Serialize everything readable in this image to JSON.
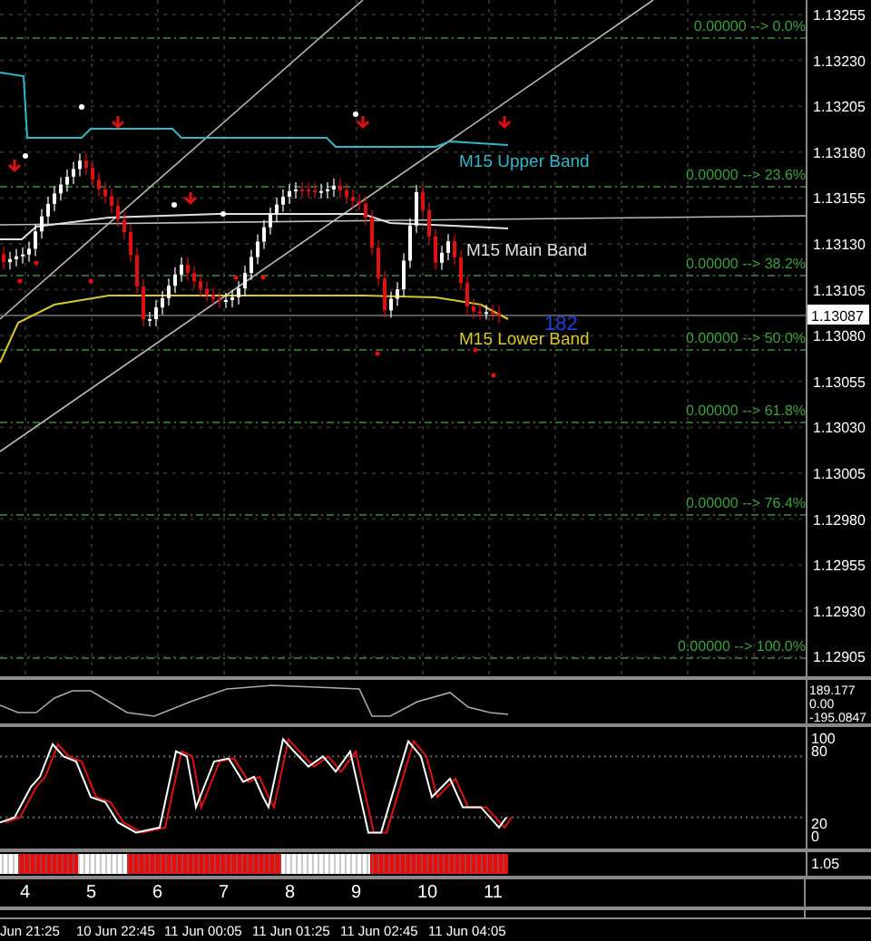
{
  "main_chart": {
    "price_axis": [
      "1.13255",
      "1.13230",
      "1.13205",
      "1.13180",
      "1.13155",
      "1.13130",
      "1.13105",
      "1.13080",
      "1.13055",
      "1.13030",
      "1.13005",
      "1.12980",
      "1.12955",
      "1.12930",
      "1.12905"
    ],
    "current_price": "1.13087",
    "fibonacci_levels": [
      {
        "label": "0.00000 --> 0.0%"
      },
      {
        "label": "0.00000 --> 23.6%"
      },
      {
        "label": "0.00000 --> 38.2%"
      },
      {
        "label": "0.00000 --> 50.0%"
      },
      {
        "label": "0.00000 --> 61.8%"
      },
      {
        "label": "0.00000 --> 76.4%"
      },
      {
        "label": "0.00000 --> 100.0%"
      }
    ],
    "bands": [
      {
        "label": "M15 Upper Band",
        "color": "#30b8c8"
      },
      {
        "label": "M15 Main Band",
        "color": "#e0e0e0"
      },
      {
        "label": "M15 Lower Band",
        "color": "#d8c830"
      }
    ],
    "counter": "182"
  },
  "cci_panel": {
    "axis": [
      "189.177",
      "0.00",
      "-195.0847"
    ]
  },
  "stochastic_panel": {
    "axis": [
      "100",
      "80",
      "20",
      "0"
    ]
  },
  "trend_bar_panel": {
    "axis": [
      "1.05"
    ]
  },
  "bar_numbers": [
    "4",
    "5",
    "6",
    "7",
    "8",
    "9",
    "10",
    "11"
  ],
  "time_axis": [
    "Jun 21:25",
    "10 Jun 22:45",
    "11 Jun 00:05",
    "11 Jun 01:25",
    "11 Jun 02:45",
    "11 Jun 04:05"
  ]
}
